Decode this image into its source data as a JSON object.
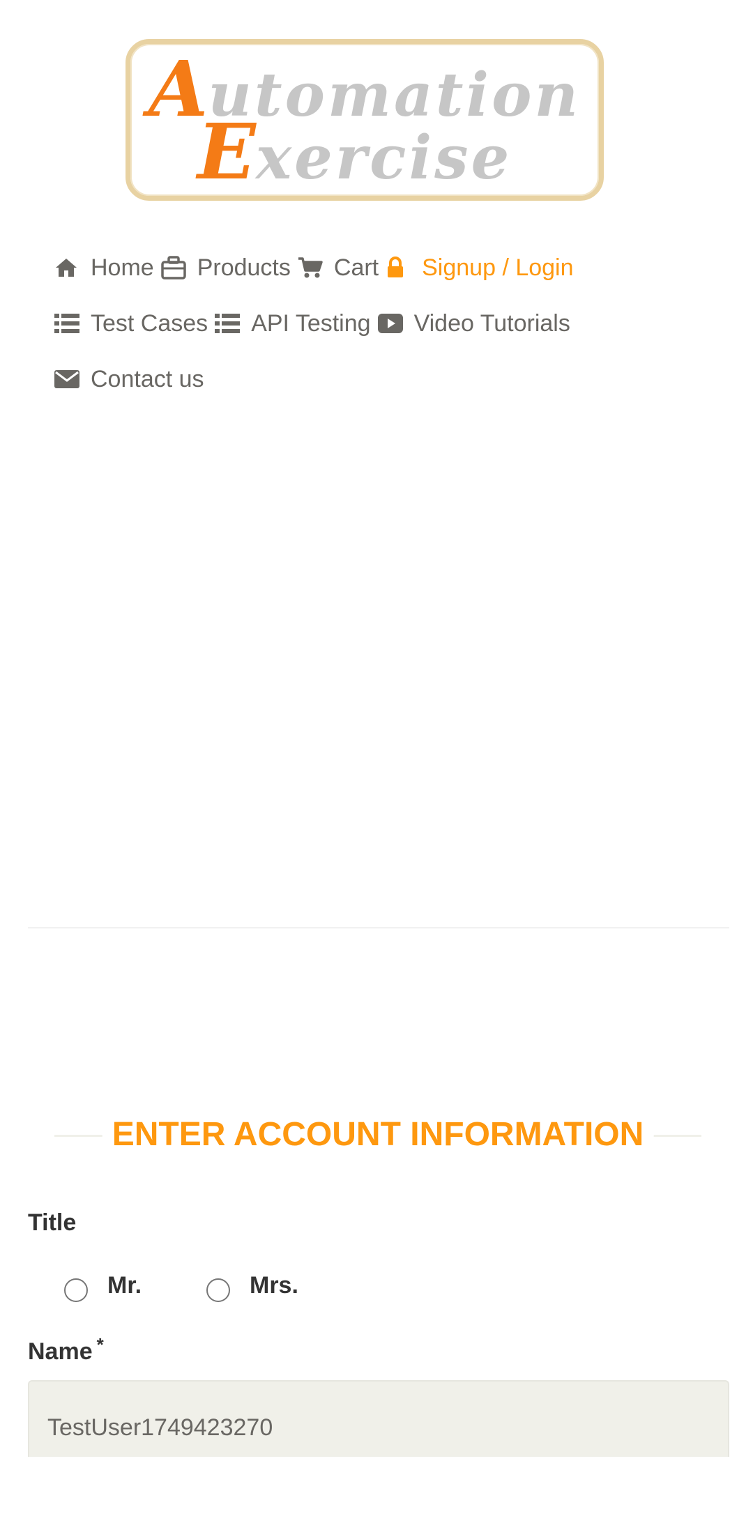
{
  "logo": {
    "line1_first": "A",
    "line1_rest": "utomation",
    "line2_first": "E",
    "line2_rest": "xercise"
  },
  "nav": {
    "home": {
      "label": "Home",
      "icon": "home-icon"
    },
    "products": {
      "label": "Products",
      "icon": "briefcase-icon"
    },
    "cart": {
      "label": "Cart",
      "icon": "cart-icon"
    },
    "signup_login": {
      "label": "Signup / Login",
      "icon": "lock-icon",
      "active": true
    },
    "test_cases": {
      "label": "Test Cases",
      "icon": "list-icon"
    },
    "api_testing": {
      "label": "API Testing",
      "icon": "list-icon"
    },
    "video_tutorials": {
      "label": "Video Tutorials",
      "icon": "youtube-play-icon"
    },
    "contact_us": {
      "label": "Contact us",
      "icon": "envelope-icon"
    }
  },
  "form": {
    "section_title": "ENTER ACCOUNT INFORMATION",
    "title_label": "Title",
    "title_options": [
      "Mr.",
      "Mrs."
    ],
    "name_label": "Name",
    "name_required_marker": "*",
    "name_value": "TestUser1749423270"
  },
  "colors": {
    "accent": "#FE980F",
    "nav_text": "#696763",
    "input_bg": "#F0F0E9"
  }
}
